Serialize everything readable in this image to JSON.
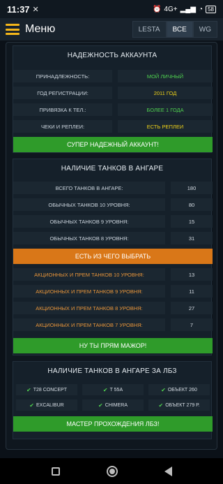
{
  "status_bar": {
    "time": "11:37",
    "network": "4G+",
    "battery": "58"
  },
  "header": {
    "title": "Меню",
    "tabs": [
      {
        "label": "LESTA"
      },
      {
        "label": "ВСЕ"
      },
      {
        "label": "WG"
      }
    ]
  },
  "reliability": {
    "title": "НАДЕЖНОСТЬ АККАУНТА",
    "rows": [
      {
        "label": "ПРИНАДЛЕЖНОСТЬ:",
        "value": "МОЙ ЛИЧНЫЙ"
      },
      {
        "label": "ГОД РЕГИСТРАЦИИ:",
        "value": "2011 ГОД"
      },
      {
        "label": "ПРИВЯЗКА К ТЕЛ.:",
        "value": "БОЛЕЕ 1 ГОДА"
      },
      {
        "label": "ЧЕКИ И РЕПЛЕИ:",
        "value": "ЕСТЬ РЕПЛЕИ"
      }
    ],
    "banner": "СУПЕР НАДЕЖНЫЙ АККАУНТ!",
    "colors": {
      "green": "#4fd14f",
      "yellow": "#f0d318"
    }
  },
  "hangar": {
    "title": "НАЛИЧИЕ ТАНКОВ В АНГАРЕ",
    "rows": [
      {
        "label": "ВСЕГО ТАНКОВ В АНГАРЕ:",
        "value": "180"
      },
      {
        "label": "ОБЫЧНЫХ ТАНКОВ 10 УРОВНЯ:",
        "value": "80"
      },
      {
        "label": "ОБЫЧНЫХ ТАНКОВ 9 УРОВНЯ:",
        "value": "15"
      },
      {
        "label": "ОБЫЧНЫХ ТАНКОВ 8 УРОВНЯ:",
        "value": "31"
      }
    ],
    "orange_banner": "ЕСТЬ ИЗ ЧЕГО ВЫБРАТЬ",
    "prem_rows": [
      {
        "label": "АКЦИОННЫХ И ПРЕМ ТАНКОВ 10 УРОВНЯ:",
        "value": "13"
      },
      {
        "label": "АКЦИОННЫХ И ПРЕМ ТАНКОВ 9 УРОВНЯ:",
        "value": "11"
      },
      {
        "label": "АКЦИОННЫХ И ПРЕМ ТАНКОВ 8 УРОВНЯ:",
        "value": "27"
      },
      {
        "label": "АКЦИОННЫХ И ПРЕМ ТАНКОВ 7 УРОВНЯ:",
        "value": "7"
      }
    ],
    "banner": "НУ ТЫ ПРЯМ МАЖОР!",
    "colors": {
      "orange": "#e8953a",
      "accent": "#d97718"
    }
  },
  "lbz": {
    "title": "НАЛИЧИЕ ТАНКОВ В АНГАРЕ ЗА ЛБЗ",
    "tanks": [
      "T28 CONCEPT",
      "T 55A",
      "ОБЪЕКТ 260",
      "EXCALIBUR",
      "CHIMERA",
      "ОБЪЕКТ 279 Р."
    ],
    "banner": "МАСТЕР ПРОХОЖДЕНИЯ ЛБЗ!"
  }
}
